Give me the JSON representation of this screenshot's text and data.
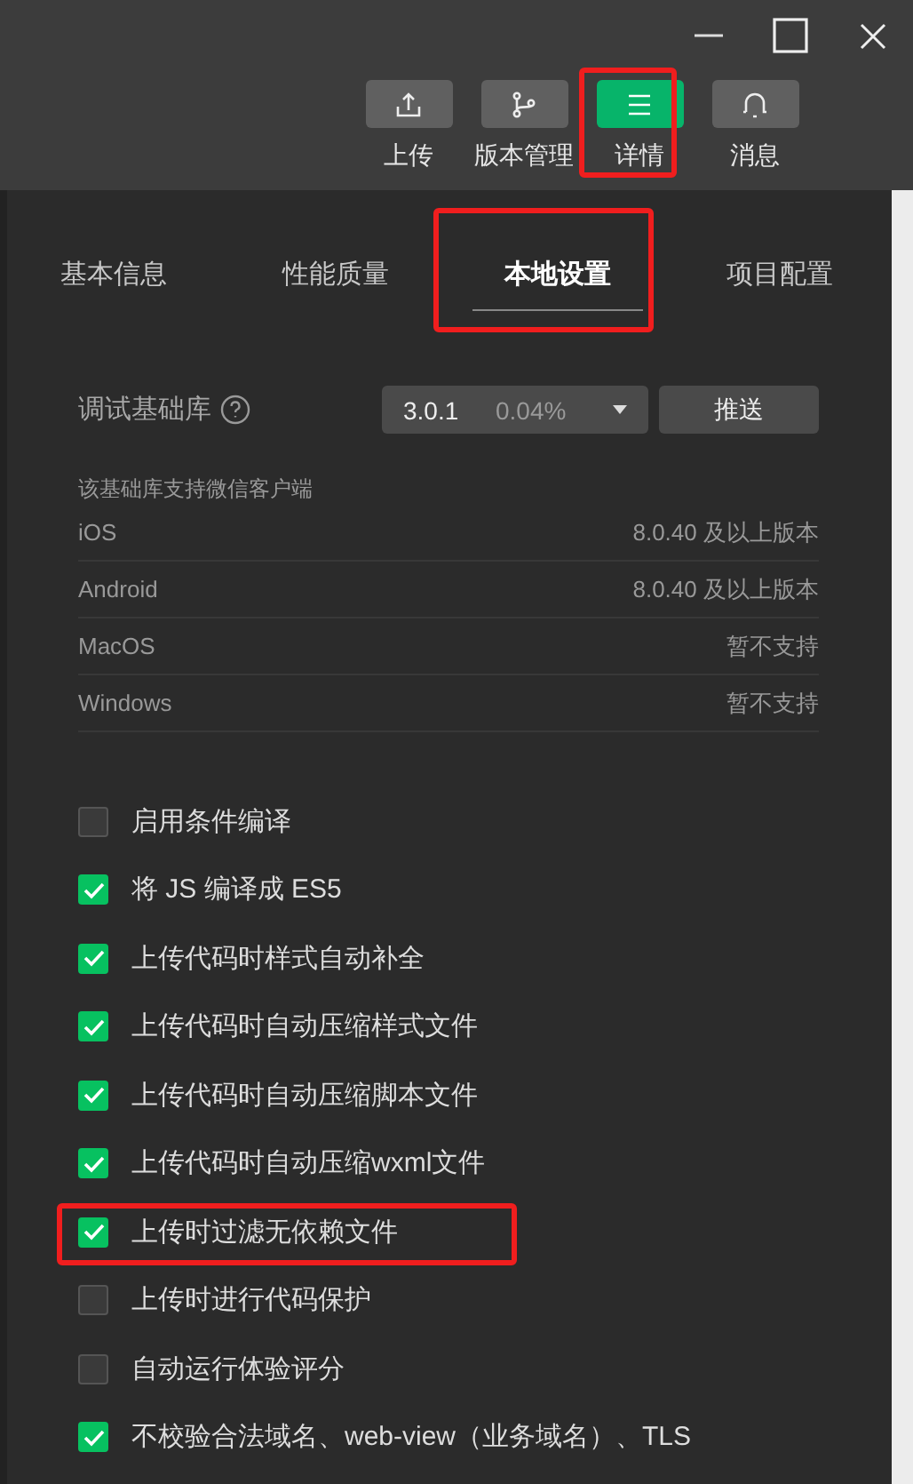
{
  "window_controls": [
    {
      "kind": "minimize"
    },
    {
      "kind": "maximize"
    },
    {
      "kind": "close"
    }
  ],
  "toolbar": [
    {
      "kind": "upload",
      "label": "上传",
      "active": false,
      "highlighted": false
    },
    {
      "kind": "branch",
      "label": "版本管理",
      "active": false,
      "highlighted": false
    },
    {
      "kind": "menu",
      "label": "详情",
      "active": true,
      "highlighted": true
    },
    {
      "kind": "bell",
      "label": "消息",
      "active": false,
      "highlighted": false
    }
  ],
  "tabs": [
    {
      "label": "基本信息",
      "selected": false,
      "highlighted": false
    },
    {
      "label": "性能质量",
      "selected": false,
      "highlighted": false
    },
    {
      "label": "本地设置",
      "selected": true,
      "highlighted": true
    },
    {
      "label": "项目配置",
      "selected": false,
      "highlighted": false
    }
  ],
  "debug_library": {
    "label": "调试基础库",
    "version": "3.0.1",
    "share": "0.04%",
    "push_button": "推送"
  },
  "support": {
    "title": "该基础库支持微信客户端",
    "rows": [
      {
        "platform": "iOS",
        "value": "8.0.40 及以上版本"
      },
      {
        "platform": "Android",
        "value": "8.0.40 及以上版本"
      },
      {
        "platform": "MacOS",
        "value": "暂不支持"
      },
      {
        "platform": "Windows",
        "value": "暂不支持"
      }
    ]
  },
  "options": [
    {
      "label": "启用条件编译",
      "checked": false,
      "highlighted": false
    },
    {
      "label": "将 JS 编译成 ES5",
      "checked": true,
      "highlighted": false
    },
    {
      "label": "上传代码时样式自动补全",
      "checked": true,
      "highlighted": false
    },
    {
      "label": "上传代码时自动压缩样式文件",
      "checked": true,
      "highlighted": false
    },
    {
      "label": "上传代码时自动压缩脚本文件",
      "checked": true,
      "highlighted": false
    },
    {
      "label": "上传代码时自动压缩wxml文件",
      "checked": true,
      "highlighted": false
    },
    {
      "label": "上传时过滤无依赖文件",
      "checked": true,
      "highlighted": true
    },
    {
      "label": "上传时进行代码保护",
      "checked": false,
      "highlighted": false
    },
    {
      "label": "自动运行体验评分",
      "checked": false,
      "highlighted": false
    },
    {
      "label": "不校验合法域名、web-view（业务域名）、TLS",
      "checked": true,
      "highlighted": false
    }
  ]
}
